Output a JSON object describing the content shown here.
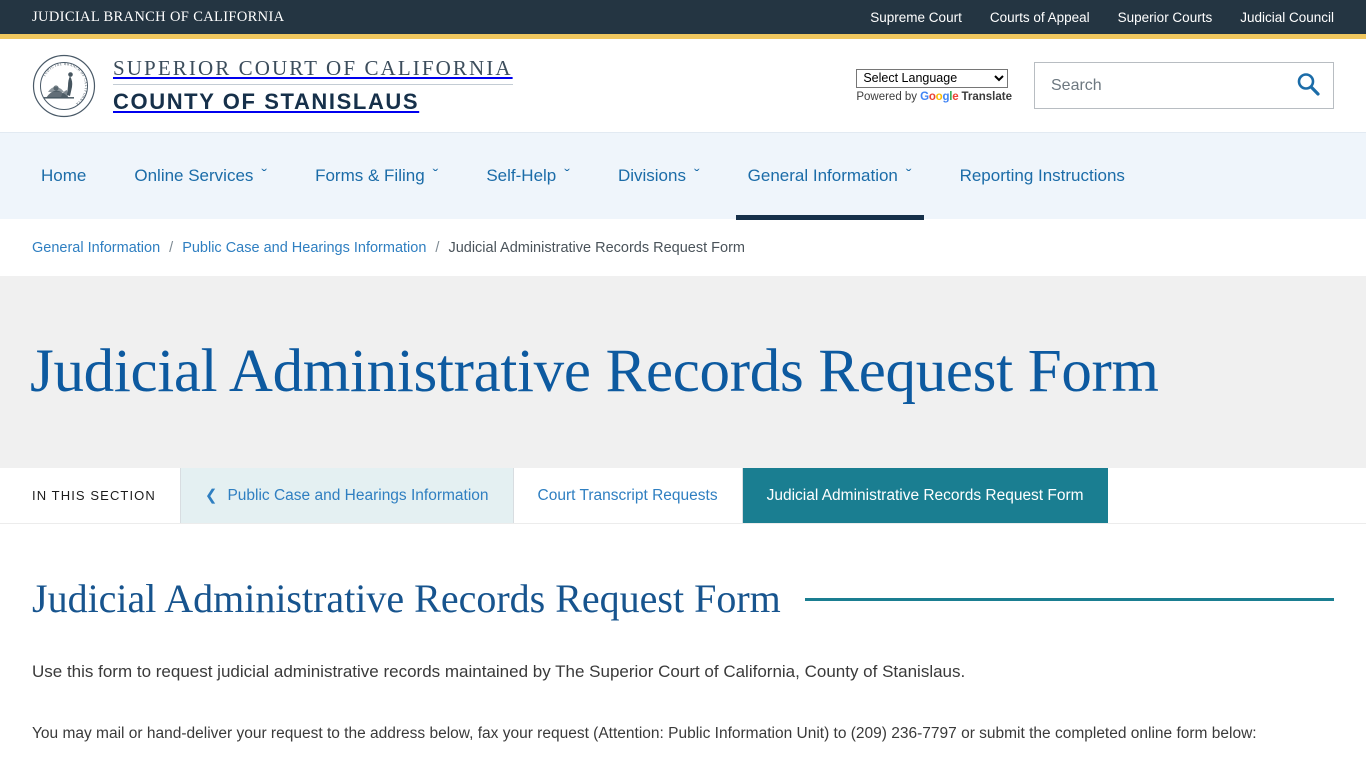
{
  "utility": {
    "brand": "JUDICIAL BRANCH OF CALIFORNIA",
    "links": [
      {
        "label": "Supreme Court"
      },
      {
        "label": "Courts of Appeal"
      },
      {
        "label": "Superior Courts"
      },
      {
        "label": "Judicial Council"
      }
    ]
  },
  "masthead": {
    "seal_icon": "california-judicial-branch-seal-icon",
    "court_line1": "SUPERIOR COURT OF CALIFORNIA",
    "court_line2": "COUNTY OF STANISLAUS",
    "translate": {
      "selected": "Select Language",
      "options": [
        "Select Language"
      ],
      "powered_prefix": "Powered by",
      "google": "Google",
      "translate_word": "Translate"
    },
    "search": {
      "placeholder": "Search",
      "value": "",
      "icon": "search-icon"
    }
  },
  "primary_nav": {
    "items": [
      {
        "label": "Home",
        "has_caret": false,
        "active": false
      },
      {
        "label": "Online Services",
        "has_caret": true,
        "active": false
      },
      {
        "label": "Forms & Filing",
        "has_caret": true,
        "active": false
      },
      {
        "label": "Self-Help",
        "has_caret": true,
        "active": false
      },
      {
        "label": "Divisions",
        "has_caret": true,
        "active": false
      },
      {
        "label": "General Information",
        "has_caret": true,
        "active": true
      },
      {
        "label": "Reporting Instructions",
        "has_caret": false,
        "active": false
      }
    ],
    "caret_glyph": "ˇ"
  },
  "breadcrumb": {
    "separator": "/",
    "items": [
      {
        "label": "General Information",
        "current": false
      },
      {
        "label": "Public Case and Hearings Information",
        "current": false
      },
      {
        "label": "Judicial Administrative Records Request Form",
        "current": true
      }
    ]
  },
  "hero": {
    "title": "Judicial Administrative Records Request Form"
  },
  "section_tabs": {
    "label": "IN THIS SECTION",
    "back_chevron": "❮",
    "tabs": [
      {
        "label": "Public Case and Hearings Information",
        "style": "parent",
        "has_back_chevron": true
      },
      {
        "label": "Court Transcript Requests",
        "style": "normal",
        "has_back_chevron": false
      },
      {
        "label": "Judicial Administrative Records Request Form",
        "style": "active",
        "has_back_chevron": false
      }
    ]
  },
  "main": {
    "heading": "Judicial Administrative Records Request Form",
    "lede": "Use this form to request judicial administrative records maintained by The Superior Court of California, County of Stanislaus.",
    "paragraph": "You may mail or hand-deliver your request to the address below, fax your request (Attention: Public Information Unit) to (209) 236-7797 or submit the completed online form below:"
  },
  "colors": {
    "utility_bar": "#243542",
    "gold_rule": "#F0C75E",
    "nav_background": "#EFF5FB",
    "nav_link": "#1b6ca8",
    "nav_active_underline": "#16304a",
    "hero_background": "#F0F0F0",
    "hero_title": "#0D5AA0",
    "tab_active": "#1A7E91",
    "tab_parent": "#E4F0F2",
    "heading_rule": "#1A7E91",
    "link": "#2f7fc1"
  }
}
